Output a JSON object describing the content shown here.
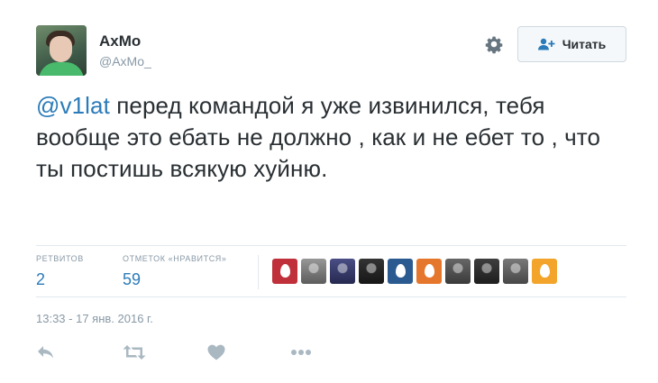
{
  "tweet": {
    "author": {
      "name": "AxMo",
      "handle": "@AxMo_"
    },
    "follow_button": {
      "label": "Читать"
    },
    "text": {
      "mention": "@v1lat",
      "body": " перед командой я уже извинился, тебя вообще это ебать не должно , как и не ебет то , что ты постишь всякую хуйню."
    },
    "stats": {
      "retweets": {
        "label": "РЕТВИТОВ",
        "value": "2"
      },
      "likes": {
        "label": "ОТМЕТОК «НРАВИТСЯ»",
        "value": "59"
      }
    },
    "likers": [
      {
        "kind": "egg",
        "color": "#c0303a"
      },
      {
        "kind": "photo",
        "color": "#8e8e8e"
      },
      {
        "kind": "photo",
        "color": "#3a3f7a"
      },
      {
        "kind": "photo",
        "color": "#222222"
      },
      {
        "kind": "egg",
        "color": "#2a5a8f"
      },
      {
        "kind": "egg",
        "color": "#e5772c"
      },
      {
        "kind": "photo",
        "color": "#5a5a5a"
      },
      {
        "kind": "photo",
        "color": "#2e2e2e"
      },
      {
        "kind": "photo",
        "color": "#6d6d6d"
      },
      {
        "kind": "egg",
        "color": "#f2a52a"
      }
    ],
    "timestamp": "13:33 - 17 янв. 2016 г.",
    "actions": [
      "reply-icon",
      "retweet-icon",
      "heart-icon",
      "more-icon"
    ]
  }
}
